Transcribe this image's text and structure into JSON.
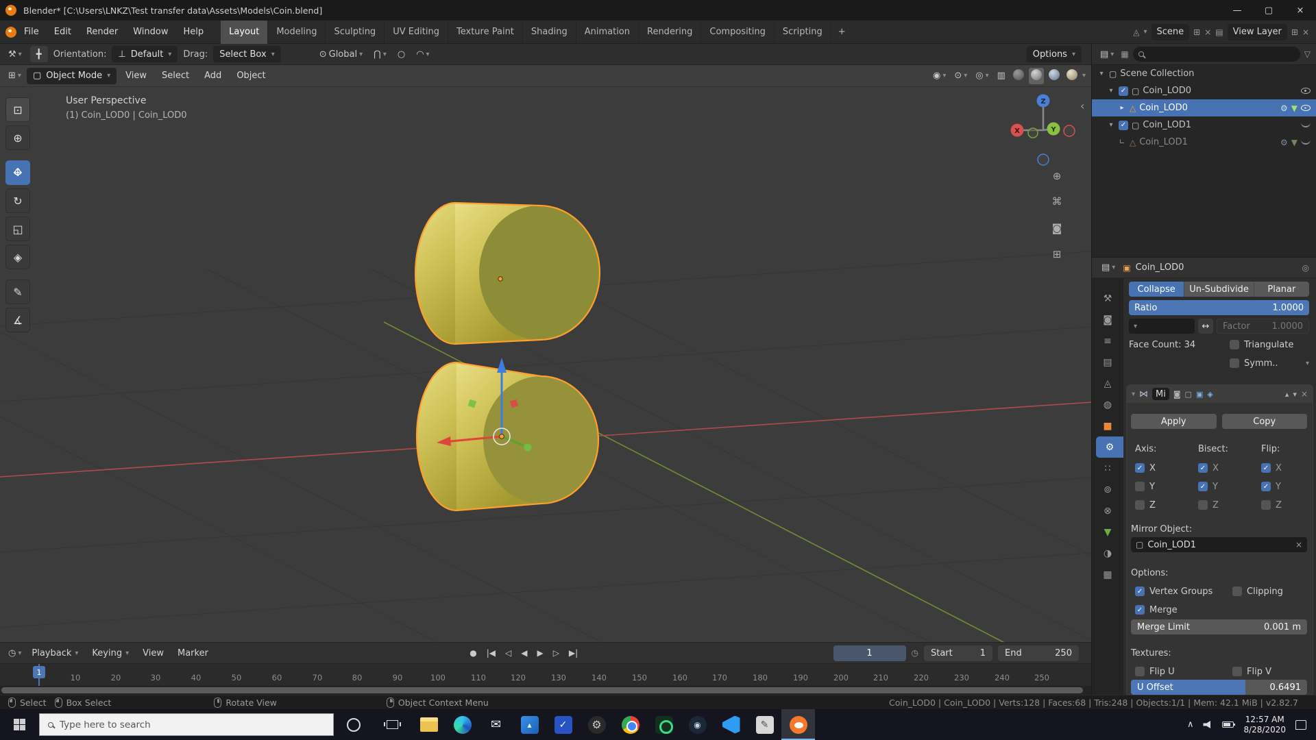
{
  "window": {
    "title": "Blender* [C:\\Users\\LNKZ\\Test transfer data\\Assets\\Models\\Coin.blend]",
    "minimize": "—",
    "restore": "▢",
    "close": "×"
  },
  "topbar": {
    "menus": [
      "File",
      "Edit",
      "Render",
      "Window",
      "Help"
    ],
    "workspaces": [
      "Layout",
      "Modeling",
      "Sculpting",
      "UV Editing",
      "Texture Paint",
      "Shading",
      "Animation",
      "Rendering",
      "Compositing",
      "Scripting"
    ],
    "active_workspace": "Layout",
    "new_workspace_button": "+",
    "scene_label": "Scene",
    "view_layer_label": "View Layer"
  },
  "tool_settings": {
    "orientation_label": "Orientation:",
    "orientation_value": "Default",
    "drag_label": "Drag:",
    "drag_value": "Select Box",
    "pivot_value": "Global",
    "options_button": "Options"
  },
  "viewport": {
    "mode_selector": "Object Mode",
    "menus": [
      "View",
      "Select",
      "Add",
      "Object"
    ],
    "overlay_line1": "User Perspective",
    "overlay_line2": "(1) Coin_LOD0 | Coin_LOD0",
    "nav_axes": {
      "x": "X",
      "y": "Y",
      "z": "Z"
    }
  },
  "outliner": {
    "rows": [
      {
        "label": "Scene Collection",
        "kind": "scene-collection"
      },
      {
        "label": "Coin_LOD0",
        "kind": "collection",
        "checked": true,
        "visible": true
      },
      {
        "label": "Coin_LOD0",
        "kind": "object",
        "selected": true,
        "visible": true
      },
      {
        "label": "Coin_LOD1",
        "kind": "collection",
        "checked": true,
        "visible": false
      },
      {
        "label": "Coin_LOD1",
        "kind": "object",
        "muted": true,
        "visible": false
      }
    ]
  },
  "properties": {
    "breadcrumb": "Coin_LOD0",
    "active_tab": "modifiers",
    "decimate": {
      "modes": [
        "Collapse",
        "Un-Subdivide",
        "Planar"
      ],
      "active_mode": "Collapse",
      "ratio_label": "Ratio",
      "ratio_value": "1.0000",
      "factor_label": "Factor",
      "factor_value": "1.0000",
      "face_count_label": "Face Count: 34",
      "triangulate_label": "Triangulate",
      "triangulate_checked": false,
      "symmetry_label": "Symm..",
      "symmetry_checked": false
    },
    "mirror": {
      "name": "Mi",
      "apply_button": "Apply",
      "copy_button": "Copy",
      "axis_label": "Axis:",
      "bisect_label": "Bisect:",
      "flip_label": "Flip:",
      "x": "X",
      "y": "Y",
      "z": "Z",
      "axis": {
        "x": true,
        "y": false,
        "z": false
      },
      "bisect": {
        "x": true,
        "y": true,
        "z": false
      },
      "flip": {
        "x": true,
        "y": true,
        "z": false
      },
      "mirror_object_label": "Mirror Object:",
      "mirror_object_value": "Coin_LOD1",
      "options_label": "Options:",
      "vertex_groups_label": "Vertex Groups",
      "vertex_groups_checked": true,
      "clipping_label": "Clipping",
      "clipping_checked": false,
      "merge_label": "Merge",
      "merge_checked": true,
      "merge_limit_label": "Merge Limit",
      "merge_limit_value": "0.001 m",
      "textures_label": "Textures:",
      "flip_u_label": "Flip U",
      "flip_u_checked": false,
      "flip_v_label": "Flip V",
      "flip_v_checked": false,
      "u_offset_label": "U Offset",
      "u_offset_value": "0.6491"
    }
  },
  "timeline": {
    "menus": [
      "Playback",
      "Keying",
      "View",
      "Marker"
    ],
    "current_frame": "1",
    "start_label": "Start",
    "start_value": "1",
    "end_label": "End",
    "end_value": "250",
    "ticks": [
      "10",
      "20",
      "30",
      "40",
      "50",
      "60",
      "70",
      "80",
      "90",
      "100",
      "110",
      "120",
      "130",
      "140",
      "150",
      "160",
      "170",
      "180",
      "190",
      "200",
      "210",
      "220",
      "230",
      "240",
      "250"
    ]
  },
  "statusbar": {
    "hints": [
      {
        "label": "Select"
      },
      {
        "label": "Box Select"
      },
      {
        "label": "Rotate View"
      },
      {
        "label": "Object Context Menu"
      }
    ],
    "stats": "Coin_LOD0 | Coin_LOD0 | Verts:128 | Faces:68 | Tris:248 | Objects:1/1 | Mem: 42.1 MiB | v2.82.7"
  },
  "taskbar": {
    "search_placeholder": "Type here to search",
    "time": "12:57 AM",
    "date": "8/28/2020",
    "active_app": "blender"
  }
}
